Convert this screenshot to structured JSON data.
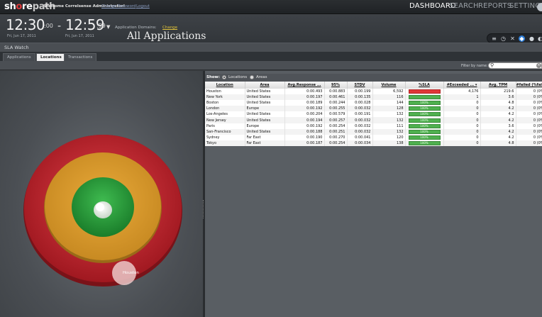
{
  "app": {
    "logo_prefix": "sh",
    "logo_accent": "o",
    "logo_mid": "re",
    "logo_suffix": "path",
    "welcome": "Welcome Correlsense Administrator!",
    "change_password": "Change Password",
    "logout": "Logout",
    "nav": [
      "DASHBOARD",
      "SEARCH",
      "REPORTS",
      "SETTINGS"
    ],
    "nav_active": "DASHBOARD"
  },
  "time": {
    "start_hm": "12:30",
    "start_sec": ":00",
    "start_date": "Fri, Jun 17, 2011",
    "dash": "-",
    "end_hm": "12:59",
    "end_sec": ":59",
    "end_date": "Fri, Jun 17, 2011",
    "domains_label": "Application Domains:",
    "domains_change": "Change",
    "domains_value": "All Applications"
  },
  "sla": {
    "title": "SLA Watch",
    "tabs": [
      "Applications",
      "Locations",
      "Transactions"
    ],
    "active_tab": "Locations",
    "filter_label": "Filter by name:",
    "filter_value": ""
  },
  "table": {
    "show_label": "Show:",
    "show_options": [
      "Locations",
      "Areas"
    ],
    "show_selected": "Locations",
    "columns": [
      "Location",
      "Area",
      "Avg.Response ...",
      "95%",
      "STDV",
      "Volume",
      "%SLA",
      "#Exceeded ... ▾",
      "Avg. TPM",
      "#failed (%failed)"
    ],
    "rows": [
      [
        "Houston",
        "United States",
        "0:00.493",
        "0:00.883",
        "0:00.199",
        "6,592",
        "",
        "4,176",
        "219.6",
        "0 (0%"
      ],
      [
        "New York",
        "United States",
        "0:00.197",
        "0:00.461",
        "0:00.135",
        "116",
        "",
        "1",
        "3.6",
        "0 (0%"
      ],
      [
        "Boston",
        "United States",
        "0:00.189",
        "0:00.244",
        "0:00.028",
        "144",
        "100%",
        "0",
        "4.8",
        "0 (0%"
      ],
      [
        "London",
        "Europe",
        "0:00.192",
        "0:00.255",
        "0:00.032",
        "128",
        "100%",
        "0",
        "4.2",
        "0 (0%"
      ],
      [
        "Los-Angeles",
        "United States",
        "0:00.204",
        "0:00.579",
        "0:00.191",
        "132",
        "100%",
        "0",
        "4.2",
        "0 (0%"
      ],
      [
        "New Jersey",
        "United States",
        "0:00.194",
        "0:00.257",
        "0:00.032",
        "132",
        "100%",
        "0",
        "4.2",
        "0 (0%"
      ],
      [
        "Paris",
        "Europe",
        "0:00.192",
        "0:00.254",
        "0:00.032",
        "111",
        "100%",
        "0",
        "3.6",
        "0 (0%"
      ],
      [
        "San-Francisco",
        "United States",
        "0:00.188",
        "0:00.251",
        "0:00.032",
        "132",
        "100%",
        "0",
        "4.2",
        "0 (0%"
      ],
      [
        "Sydney",
        "Far East",
        "0:00.190",
        "0:00.270",
        "0:00.041",
        "120",
        "100%",
        "0",
        "4.2",
        "0 (0%"
      ],
      [
        "Tokyo",
        "Far East",
        "0:00.187",
        "0:00.254",
        "0:00.034",
        "138",
        "100%",
        "0",
        "4.8",
        "0 (0%"
      ]
    ],
    "sla_fractions": [
      0.37,
      1.0,
      1.0,
      1.0,
      1.0,
      1.0,
      1.0,
      1.0,
      1.0,
      1.0
    ]
  },
  "radar": {
    "rings": [
      "#c8202a",
      "#d8992a",
      "#2a9a3a"
    ],
    "bubble_label": "Houston"
  },
  "colors": {
    "sla_good": "#4fb04f",
    "sla_bad": "#e03838",
    "accent": "#2f7fd8",
    "change_link": "#e0c23a"
  }
}
